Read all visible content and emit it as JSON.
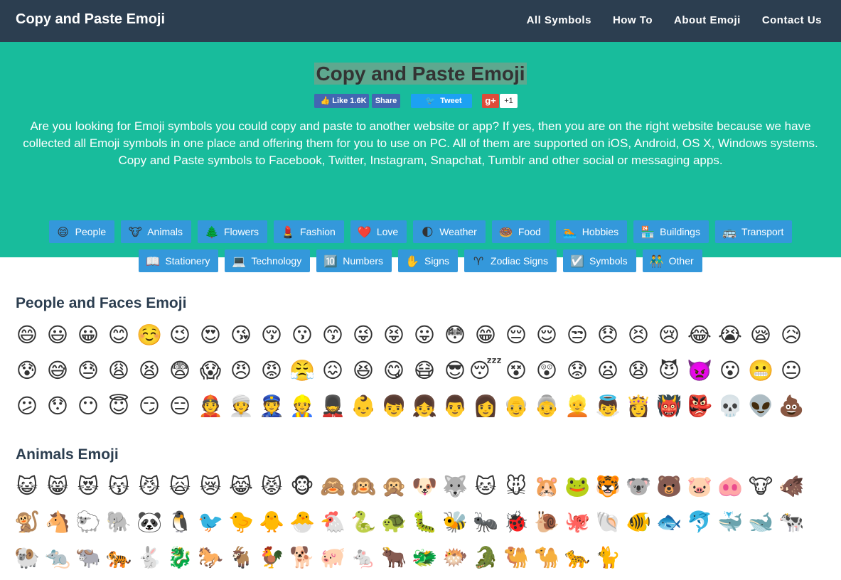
{
  "brand": "Copy and Paste Emoji",
  "nav": [
    "All Symbols",
    "How To",
    "About Emoji",
    "Contact Us"
  ],
  "hero": {
    "title": "Copy and Paste Emoji",
    "social": {
      "like_label": "Like 1.6K",
      "share_label": "Share",
      "tweet_label": "Tweet",
      "gplus_label": "g+",
      "gplus_count": "+1"
    },
    "intro": "Are you looking for Emoji symbols you could copy and paste to another website or app? If yes, then you are on the right website because we have collected all Emoji symbols in one place and offering them for you to use on PC. All of them are supported on iOS, Android, OS X, Windows systems. Copy and Paste symbols to Facebook, Twitter, Instagram, Snapchat, Tumblr and other social or messaging apps.",
    "categories": [
      {
        "label": "People",
        "icon": "😄"
      },
      {
        "label": "Animals",
        "icon": "🐮"
      },
      {
        "label": "Flowers",
        "icon": "🌲"
      },
      {
        "label": "Fashion",
        "icon": "💄"
      },
      {
        "label": "Love",
        "icon": "❤️"
      },
      {
        "label": "Weather",
        "icon": "🌓"
      },
      {
        "label": "Food",
        "icon": "🍩"
      },
      {
        "label": "Hobbies",
        "icon": "🏊"
      },
      {
        "label": "Buildings",
        "icon": "🏪"
      },
      {
        "label": "Transport",
        "icon": "🚌"
      },
      {
        "label": "Stationery",
        "icon": "📖"
      },
      {
        "label": "Technology",
        "icon": "💻"
      },
      {
        "label": "Numbers",
        "icon": "🔟"
      },
      {
        "label": "Signs",
        "icon": "✋"
      },
      {
        "label": "Zodiac Signs",
        "icon": "♈"
      },
      {
        "label": "Symbols",
        "icon": "☑️"
      },
      {
        "label": "Other",
        "icon": "👬"
      }
    ]
  },
  "sections": [
    {
      "title": "People and Faces Emoji",
      "emojis": [
        "😄",
        "😃",
        "😀",
        "😊",
        "☺️",
        "😉",
        "😍",
        "😘",
        "😚",
        "😗",
        "😙",
        "😜",
        "😝",
        "😛",
        "😳",
        "😁",
        "😔",
        "😌",
        "😒",
        "😞",
        "😣",
        "😢",
        "😂",
        "😭",
        "😪",
        "😥",
        "😰",
        "😅",
        "😓",
        "😩",
        "😫",
        "😨",
        "😱",
        "😠",
        "😡",
        "😤",
        "😖",
        "😆",
        "😋",
        "😷",
        "😎",
        "😴",
        "😵",
        "😲",
        "😟",
        "😦",
        "😧",
        "😈",
        "👿",
        "😮",
        "😬",
        "😐",
        "😕",
        "😯",
        "😶",
        "😇",
        "😏",
        "😑",
        "👲",
        "👳",
        "👮",
        "👷",
        "💂",
        "👶",
        "👦",
        "👧",
        "👨",
        "👩",
        "👴",
        "👵",
        "👱",
        "👼",
        "👸",
        "👹",
        "👺",
        "💀",
        "👽",
        "💩"
      ]
    },
    {
      "title": "Animals Emoji",
      "emojis": [
        "😺",
        "😸",
        "😻",
        "😽",
        "😼",
        "🙀",
        "😿",
        "😹",
        "😾",
        "🐵",
        "🙈",
        "🙉",
        "🙊",
        "🐶",
        "🐺",
        "🐱",
        "🐭",
        "🐹",
        "🐸",
        "🐯",
        "🐨",
        "🐻",
        "🐷",
        "🐽",
        "🐮",
        "🐗",
        "🐒",
        "🐴",
        "🐑",
        "🐘",
        "🐼",
        "🐧",
        "🐦",
        "🐤",
        "🐥",
        "🐣",
        "🐔",
        "🐍",
        "🐢",
        "🐛",
        "🐝",
        "🐜",
        "🐞",
        "🐌",
        "🐙",
        "🐚",
        "🐠",
        "🐟",
        "🐬",
        "🐳",
        "🐋",
        "🐄",
        "🐏",
        "🐀",
        "🐃",
        "🐅",
        "🐇",
        "🐉",
        "🐎",
        "🐐",
        "🐓",
        "🐕",
        "🐖",
        "🐁",
        "🐂",
        "🐲",
        "🐡",
        "🐊",
        "🐫",
        "🐪",
        "🐆",
        "🐈"
      ]
    }
  ]
}
